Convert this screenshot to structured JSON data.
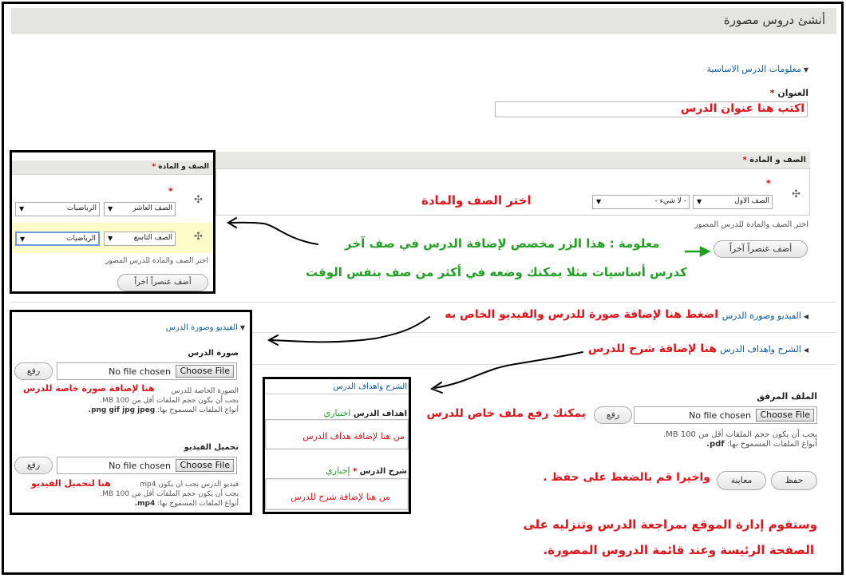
{
  "page": {
    "title": "أنشئ دروس مصورة"
  },
  "basic": {
    "legend": "معلومات الدرس الاساسية",
    "title_label": "العنوان",
    "required": "*",
    "title_value": "اكتب هنا عنوان الدرس"
  },
  "grade": {
    "header": "الصف و المادة",
    "select_grade": "الصف الاول",
    "select_subject": "- لا شيء -",
    "note": "اختر الصف والمادة للدرس المصور",
    "add_button": "أضف عنصراً آخراً",
    "hint": "اختر الصف والمادة"
  },
  "inset_grade": {
    "header": "الصف و المادة",
    "row1_grade": "الصف العاشر",
    "row1_subject": "الرياضيات",
    "row2_grade": "الصف التاسع",
    "row2_subject": "الرياضيات",
    "note": "اختر الصف والمادة للدرس المصور",
    "add_button": "أضف عنصراً آخراً"
  },
  "info": {
    "line1": "معلومة : هذا الزر مخصص لإضافة الدرس في صف آخر",
    "line2": "كدرس أساسيات مثلا يمكنك وضعه في أكثر من صف بنفس الوقت"
  },
  "video": {
    "legend": "الفيديو وصورة الدرس",
    "hint": "اضغط هنا لإضافة صورة للدرس والفيديو الخاص به"
  },
  "explain": {
    "legend": "الشرح واهداف الدرس",
    "hint": "هنا لإضافة شرح للدرس"
  },
  "attach": {
    "label": "الملف المرفق",
    "no_file": "No file chosen",
    "choose": "Choose File",
    "upload": "رفع",
    "size_note": "يجب أن يكون حجم الملفات أقل من 100 MB.",
    "types_prefix": "أنواع الملفات المسموح بها:",
    "types": "pdf.",
    "hint": "يمكنك رفع ملف خاص للدرس"
  },
  "actions": {
    "save": "حفظ",
    "preview": "معاينة",
    "hint": "واخيرا قم بالضغط على حفظ ."
  },
  "footer": {
    "line1": "وستقوم إدارة الموقع بمراجعة الدرس وتنزليه على",
    "line2": "الصفحة الرئيسة وعند قائمة الدروس المصورة."
  },
  "inset_video": {
    "legend": "الفيديو وصورة الدرس",
    "image_label": "صورة الدرس",
    "no_file": "No file chosen",
    "choose": "Choose File",
    "upload": "رفع",
    "image_desc": "الصورة الخاصة للدرس",
    "image_hint": "هنا لإضافة صورة خاصة للدرس",
    "size_note": "يجب أن يكون حجم الملفات أقل من 100 MB.",
    "types_prefix": "أنواع الملفات المسموح بها:",
    "image_types": "png gif jpg jpeg.",
    "video_label": "تحميل الفيديو",
    "video_desc": "فيديو الدرس يجب ان يكون mp4",
    "video_hint": "هنا لتحميل الفيديو",
    "video_types": "mp4."
  },
  "inset_explain": {
    "legend": "الشرح واهداف الدرس",
    "goals_label": "اهداف الدرس",
    "optional": "اختياري",
    "goals_hint": "من هنا لإضافة هداف الدرس",
    "explain_label": "شرح الدرس",
    "required": "*",
    "mandatory": "إجباري",
    "explain_hint": "من هنا لإضافة شرح للدرس"
  },
  "icons": {
    "drag": "drag-handle-icon",
    "collapse": "triangle-down-icon",
    "expand": "triangle-left-icon",
    "arrow": "hand-drawn-arrow-icon"
  },
  "colors": {
    "accent_red": "#e0141a",
    "accent_green": "#22a023",
    "link_blue": "#0a5aa0",
    "header_gray": "#e4e4e0"
  }
}
